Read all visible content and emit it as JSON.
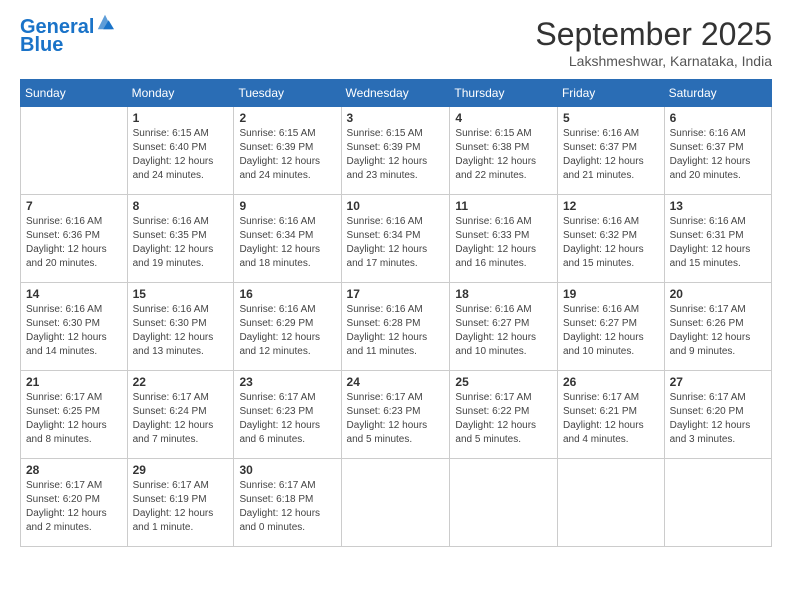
{
  "header": {
    "logo_line1": "General",
    "logo_line2": "Blue",
    "month": "September 2025",
    "location": "Lakshmeshwar, Karnataka, India"
  },
  "weekdays": [
    "Sunday",
    "Monday",
    "Tuesday",
    "Wednesday",
    "Thursday",
    "Friday",
    "Saturday"
  ],
  "weeks": [
    [
      {
        "date": "",
        "info": ""
      },
      {
        "date": "1",
        "info": "Sunrise: 6:15 AM\nSunset: 6:40 PM\nDaylight: 12 hours\nand 24 minutes."
      },
      {
        "date": "2",
        "info": "Sunrise: 6:15 AM\nSunset: 6:39 PM\nDaylight: 12 hours\nand 24 minutes."
      },
      {
        "date": "3",
        "info": "Sunrise: 6:15 AM\nSunset: 6:39 PM\nDaylight: 12 hours\nand 23 minutes."
      },
      {
        "date": "4",
        "info": "Sunrise: 6:15 AM\nSunset: 6:38 PM\nDaylight: 12 hours\nand 22 minutes."
      },
      {
        "date": "5",
        "info": "Sunrise: 6:16 AM\nSunset: 6:37 PM\nDaylight: 12 hours\nand 21 minutes."
      },
      {
        "date": "6",
        "info": "Sunrise: 6:16 AM\nSunset: 6:37 PM\nDaylight: 12 hours\nand 20 minutes."
      }
    ],
    [
      {
        "date": "7",
        "info": "Sunrise: 6:16 AM\nSunset: 6:36 PM\nDaylight: 12 hours\nand 20 minutes."
      },
      {
        "date": "8",
        "info": "Sunrise: 6:16 AM\nSunset: 6:35 PM\nDaylight: 12 hours\nand 19 minutes."
      },
      {
        "date": "9",
        "info": "Sunrise: 6:16 AM\nSunset: 6:34 PM\nDaylight: 12 hours\nand 18 minutes."
      },
      {
        "date": "10",
        "info": "Sunrise: 6:16 AM\nSunset: 6:34 PM\nDaylight: 12 hours\nand 17 minutes."
      },
      {
        "date": "11",
        "info": "Sunrise: 6:16 AM\nSunset: 6:33 PM\nDaylight: 12 hours\nand 16 minutes."
      },
      {
        "date": "12",
        "info": "Sunrise: 6:16 AM\nSunset: 6:32 PM\nDaylight: 12 hours\nand 15 minutes."
      },
      {
        "date": "13",
        "info": "Sunrise: 6:16 AM\nSunset: 6:31 PM\nDaylight: 12 hours\nand 15 minutes."
      }
    ],
    [
      {
        "date": "14",
        "info": "Sunrise: 6:16 AM\nSunset: 6:30 PM\nDaylight: 12 hours\nand 14 minutes."
      },
      {
        "date": "15",
        "info": "Sunrise: 6:16 AM\nSunset: 6:30 PM\nDaylight: 12 hours\nand 13 minutes."
      },
      {
        "date": "16",
        "info": "Sunrise: 6:16 AM\nSunset: 6:29 PM\nDaylight: 12 hours\nand 12 minutes."
      },
      {
        "date": "17",
        "info": "Sunrise: 6:16 AM\nSunset: 6:28 PM\nDaylight: 12 hours\nand 11 minutes."
      },
      {
        "date": "18",
        "info": "Sunrise: 6:16 AM\nSunset: 6:27 PM\nDaylight: 12 hours\nand 10 minutes."
      },
      {
        "date": "19",
        "info": "Sunrise: 6:16 AM\nSunset: 6:27 PM\nDaylight: 12 hours\nand 10 minutes."
      },
      {
        "date": "20",
        "info": "Sunrise: 6:17 AM\nSunset: 6:26 PM\nDaylight: 12 hours\nand 9 minutes."
      }
    ],
    [
      {
        "date": "21",
        "info": "Sunrise: 6:17 AM\nSunset: 6:25 PM\nDaylight: 12 hours\nand 8 minutes."
      },
      {
        "date": "22",
        "info": "Sunrise: 6:17 AM\nSunset: 6:24 PM\nDaylight: 12 hours\nand 7 minutes."
      },
      {
        "date": "23",
        "info": "Sunrise: 6:17 AM\nSunset: 6:23 PM\nDaylight: 12 hours\nand 6 minutes."
      },
      {
        "date": "24",
        "info": "Sunrise: 6:17 AM\nSunset: 6:23 PM\nDaylight: 12 hours\nand 5 minutes."
      },
      {
        "date": "25",
        "info": "Sunrise: 6:17 AM\nSunset: 6:22 PM\nDaylight: 12 hours\nand 5 minutes."
      },
      {
        "date": "26",
        "info": "Sunrise: 6:17 AM\nSunset: 6:21 PM\nDaylight: 12 hours\nand 4 minutes."
      },
      {
        "date": "27",
        "info": "Sunrise: 6:17 AM\nSunset: 6:20 PM\nDaylight: 12 hours\nand 3 minutes."
      }
    ],
    [
      {
        "date": "28",
        "info": "Sunrise: 6:17 AM\nSunset: 6:20 PM\nDaylight: 12 hours\nand 2 minutes."
      },
      {
        "date": "29",
        "info": "Sunrise: 6:17 AM\nSunset: 6:19 PM\nDaylight: 12 hours\nand 1 minute."
      },
      {
        "date": "30",
        "info": "Sunrise: 6:17 AM\nSunset: 6:18 PM\nDaylight: 12 hours\nand 0 minutes."
      },
      {
        "date": "",
        "info": ""
      },
      {
        "date": "",
        "info": ""
      },
      {
        "date": "",
        "info": ""
      },
      {
        "date": "",
        "info": ""
      }
    ]
  ]
}
